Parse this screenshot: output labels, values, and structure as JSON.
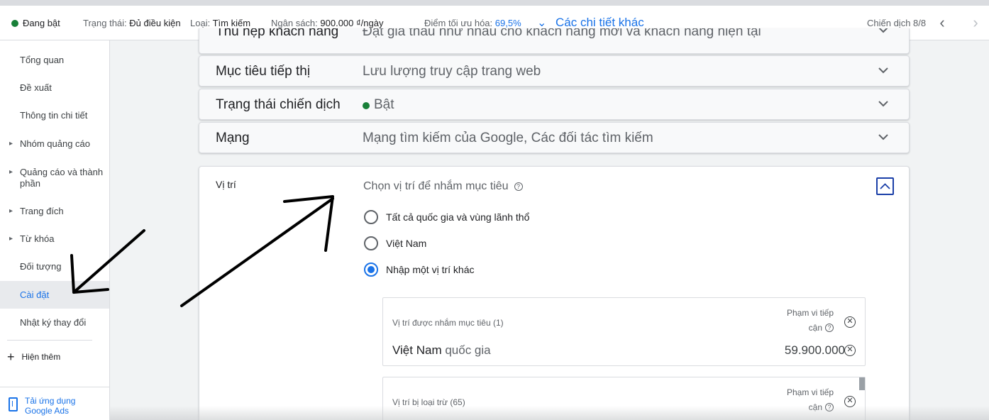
{
  "header": {
    "status": "Đang bật",
    "state_label": "Trạng thái:",
    "state_value": "Đủ điều kiện",
    "type_label": "Loại:",
    "type_value": "Tìm kiếm",
    "budget_label": "Ngân sách:",
    "budget_value": "900.000 ₫/ngày",
    "opt_label": "Điểm tối ưu hóa:",
    "opt_value": "69,5%",
    "more_details": "Các chi tiết khác",
    "campaign_count": "Chiến dịch 8/8"
  },
  "sidebar": {
    "items": [
      {
        "label": "Tổng quan"
      },
      {
        "label": "Đề xuất"
      },
      {
        "label": "Thông tin chi tiết"
      },
      {
        "label": "Nhóm quảng cáo"
      },
      {
        "label": "Quảng cáo và thành phần"
      },
      {
        "label": "Trang đích"
      },
      {
        "label": "Từ khóa"
      },
      {
        "label": "Đối tượng"
      },
      {
        "label": "Cài đặt"
      },
      {
        "label": "Nhật ký thay đổi"
      }
    ],
    "show_more": "Hiện thêm",
    "download_app": "Tải ứng dụng Google Ads"
  },
  "settings": {
    "partial_label": "Thu hẹp khách hàng",
    "partial_value": "Đặt giá thầu như nhau cho khách hàng mới và khách hàng hiện tại",
    "goal_label": "Mục tiêu tiếp thị",
    "goal_value": "Lưu lượng truy cập trang web",
    "campaign_status_label": "Trạng thái chiến dịch",
    "campaign_status_value": "Bật",
    "network_label": "Mạng",
    "network_value": "Mạng tìm kiếm của Google, Các đối tác tìm kiếm"
  },
  "location": {
    "title": "Vị trí",
    "choose_title": "Chọn vị trí để nhắm mục tiêu",
    "options": [
      {
        "label": "Tất cả quốc gia và vùng lãnh thổ",
        "selected": false
      },
      {
        "label": "Việt Nam",
        "selected": false
      },
      {
        "label": "Nhập một vị trí khác",
        "selected": true
      }
    ],
    "targeted": {
      "header": "Vị trí được nhắm mục tiêu (1)",
      "reach_label": "Phạm vi tiếp cận",
      "item_name": "Việt Nam",
      "item_type": "quốc gia",
      "item_reach": "59.900.000"
    },
    "excluded": {
      "header": "Vị trí bị loại trừ (65)",
      "reach_label": "Phạm vi tiếp cận"
    }
  },
  "colors": {
    "accent": "#1a73e8",
    "status_green": "#188038",
    "active_nav_bg": "#e8eaed"
  }
}
